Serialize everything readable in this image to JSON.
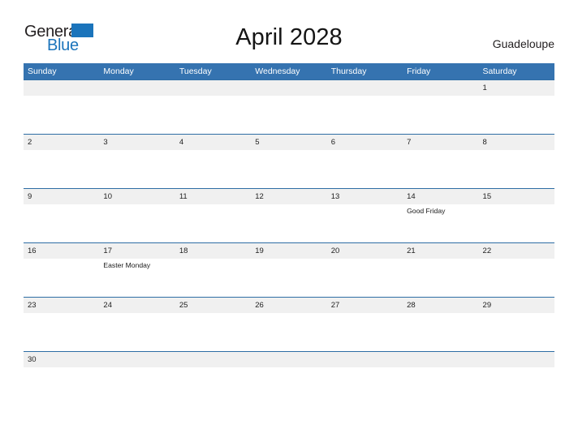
{
  "brand": {
    "word_one": "General",
    "word_two": "Blue",
    "flag_icon": "triangle-flag-icon",
    "color_primary": "#1b74bb",
    "color_text": "#231f20"
  },
  "header": {
    "title": "April 2028",
    "region": "Guadeloupe"
  },
  "calendar": {
    "accent_header_color": "#3573b0",
    "rule_color": "#2e6da4",
    "band_color": "#f0f0f0",
    "weekdays": [
      "Sunday",
      "Monday",
      "Tuesday",
      "Wednesday",
      "Thursday",
      "Friday",
      "Saturday"
    ],
    "weeks": [
      {
        "days": [
          {
            "num": "",
            "event": ""
          },
          {
            "num": "",
            "event": ""
          },
          {
            "num": "",
            "event": ""
          },
          {
            "num": "",
            "event": ""
          },
          {
            "num": "",
            "event": ""
          },
          {
            "num": "",
            "event": ""
          },
          {
            "num": "1",
            "event": ""
          }
        ]
      },
      {
        "days": [
          {
            "num": "2",
            "event": ""
          },
          {
            "num": "3",
            "event": ""
          },
          {
            "num": "4",
            "event": ""
          },
          {
            "num": "5",
            "event": ""
          },
          {
            "num": "6",
            "event": ""
          },
          {
            "num": "7",
            "event": ""
          },
          {
            "num": "8",
            "event": ""
          }
        ]
      },
      {
        "days": [
          {
            "num": "9",
            "event": ""
          },
          {
            "num": "10",
            "event": ""
          },
          {
            "num": "11",
            "event": ""
          },
          {
            "num": "12",
            "event": ""
          },
          {
            "num": "13",
            "event": ""
          },
          {
            "num": "14",
            "event": "Good Friday"
          },
          {
            "num": "15",
            "event": ""
          }
        ]
      },
      {
        "days": [
          {
            "num": "16",
            "event": ""
          },
          {
            "num": "17",
            "event": "Easter Monday"
          },
          {
            "num": "18",
            "event": ""
          },
          {
            "num": "19",
            "event": ""
          },
          {
            "num": "20",
            "event": ""
          },
          {
            "num": "21",
            "event": ""
          },
          {
            "num": "22",
            "event": ""
          }
        ]
      },
      {
        "days": [
          {
            "num": "23",
            "event": ""
          },
          {
            "num": "24",
            "event": ""
          },
          {
            "num": "25",
            "event": ""
          },
          {
            "num": "26",
            "event": ""
          },
          {
            "num": "27",
            "event": ""
          },
          {
            "num": "28",
            "event": ""
          },
          {
            "num": "29",
            "event": ""
          }
        ]
      },
      {
        "short": true,
        "days": [
          {
            "num": "30",
            "event": ""
          },
          {
            "num": "",
            "event": ""
          },
          {
            "num": "",
            "event": ""
          },
          {
            "num": "",
            "event": ""
          },
          {
            "num": "",
            "event": ""
          },
          {
            "num": "",
            "event": ""
          },
          {
            "num": "",
            "event": ""
          }
        ]
      }
    ]
  }
}
